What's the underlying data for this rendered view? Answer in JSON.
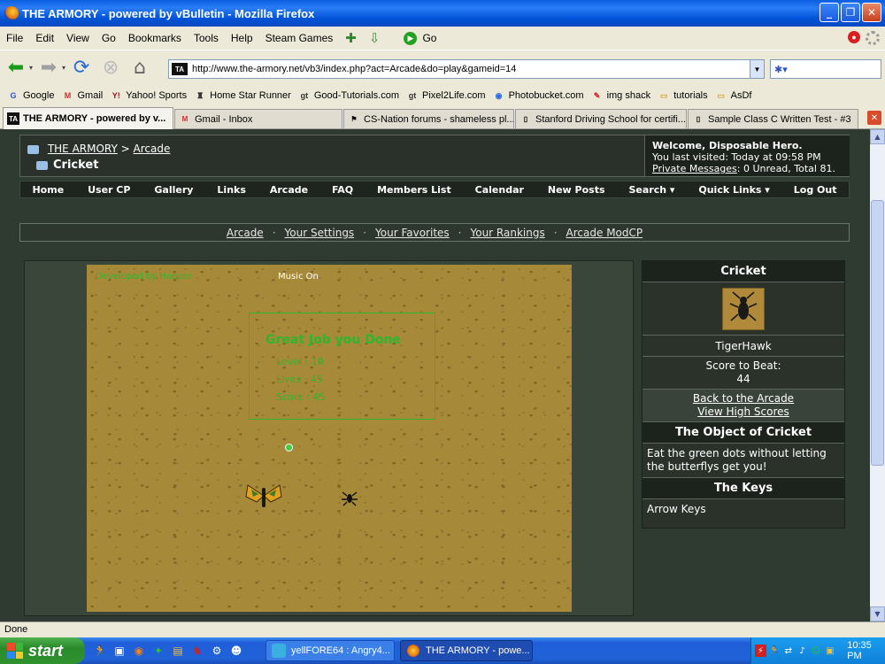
{
  "window": {
    "title": "THE ARMORY - powered by vBulletin - Mozilla Firefox",
    "buttons": [
      "_",
      "❐",
      "✕"
    ]
  },
  "menu": [
    "File",
    "Edit",
    "View",
    "Go",
    "Bookmarks",
    "Tools",
    "Help",
    "Steam Games"
  ],
  "go_label": "Go",
  "url": "http://www.the-armory.net/vb3/index.php?act=Arcade&do=play&gameid=14",
  "url_favicon": "TA",
  "bookmarks": [
    {
      "label": "Google",
      "icon": "G",
      "color": "#2a5ad8"
    },
    {
      "label": "Gmail",
      "icon": "M",
      "color": "#d82a2a"
    },
    {
      "label": "Yahoo! Sports",
      "icon": "Y!",
      "color": "#8a1a1a"
    },
    {
      "label": "Home Star Runner",
      "icon": "♜",
      "color": "#333333"
    },
    {
      "label": "Good-Tutorials.com",
      "icon": "gt",
      "color": "#333333"
    },
    {
      "label": "Pixel2Life.com",
      "icon": "gt",
      "color": "#333333"
    },
    {
      "label": "Photobucket.com",
      "icon": "◉",
      "color": "#2a6ad8"
    },
    {
      "label": "img shack",
      "icon": "✎",
      "color": "#c82a2a"
    },
    {
      "label": "tutorials",
      "icon": "▭",
      "color": "#d8a82a"
    },
    {
      "label": "AsDf",
      "icon": "▭",
      "color": "#d8a82a"
    }
  ],
  "tabs": [
    {
      "label": "THE ARMORY - powered by v...",
      "icon": "TA",
      "active": true
    },
    {
      "label": "Gmail - Inbox",
      "icon": "M",
      "active": false
    },
    {
      "label": "CS-Nation forums - shameless pl...",
      "icon": "⚑",
      "active": false
    },
    {
      "label": "Stanford Driving School for certifi...",
      "icon": "▯",
      "active": false
    },
    {
      "label": "Sample Class C Written Test - #3",
      "icon": "▯",
      "active": false
    }
  ],
  "breadcrumb": {
    "site": "THE ARMORY",
    "separator": ">",
    "section": "Arcade",
    "current": "Cricket"
  },
  "welcome": {
    "title": "Welcome, Disposable Hero.",
    "last_visit": "You last visited: Today at 09:58 PM",
    "pm_link": "Private Messages",
    "pm_stats": ": 0 Unread, Total 81."
  },
  "mainnav": [
    "Home",
    "User CP",
    "Gallery",
    "Links",
    "Arcade",
    "FAQ",
    "Members List",
    "Calendar",
    "New Posts",
    "Search ▾",
    "Quick Links ▾",
    "Log Out"
  ],
  "subnav": [
    "Arcade",
    "Your Settings",
    "Your Favorites",
    "Your Rankings",
    "Arcade ModCP"
  ],
  "subnav_sep": "·",
  "game": {
    "credit": "Developed by Hopper",
    "music": "Music  On",
    "headline": "Great Job you Done",
    "stats": [
      "Level :   10",
      "Lives :   45",
      "Score :   45"
    ]
  },
  "sidebar": {
    "game_title": "Cricket",
    "player": "TigerHawk",
    "score_label": "Score to Beat:",
    "score_value": "44",
    "back_link": "Back to the Arcade",
    "scores_link": "View High Scores",
    "object_title": "The Object of Cricket",
    "object_text": "Eat the green dots without letting the butterflys get you!",
    "keys_title": "The Keys",
    "keys_text": "Arrow Keys"
  },
  "status": "Done",
  "taskbar": {
    "start": "start",
    "tasks": [
      {
        "label": "yellFORE64 : Angry4...",
        "active": false
      },
      {
        "label": "THE ARMORY - powe...",
        "active": true
      }
    ],
    "clock": "10:35 PM"
  },
  "colors": {
    "accent_green": "#2fb52f",
    "page_bg": "#2f3a30",
    "sand": "#a68a3a"
  }
}
